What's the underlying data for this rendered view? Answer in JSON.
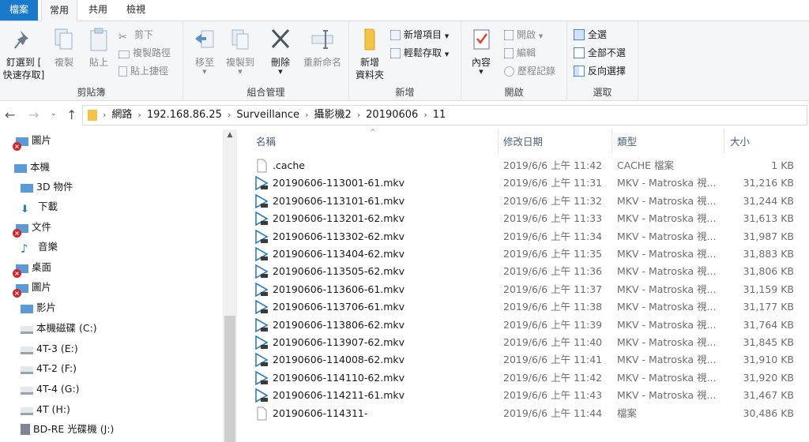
{
  "tabs": [
    {
      "label": "檔案"
    },
    {
      "label": "常用"
    },
    {
      "label": "共用"
    },
    {
      "label": "檢視"
    }
  ],
  "ribbon": {
    "clipboard": {
      "label": "剪貼簿",
      "pin": "釘選到 [\n快速存取]",
      "copy": "複製",
      "paste": "貼上",
      "cut": "剪下",
      "copy_path": "複製路徑",
      "paste_shortcut": "貼上捷徑"
    },
    "organize": {
      "label": "組合管理",
      "move_to": "移至",
      "copy_to": "複製到",
      "delete": "刪除",
      "rename": "重新命名"
    },
    "new": {
      "label": "新增",
      "new_folder": "新增\n資料夾",
      "new_item": "新增項目",
      "easy_access": "輕鬆存取"
    },
    "open": {
      "label": "開啟",
      "properties": "內容",
      "open": "開啟",
      "edit": "編輯",
      "history": "歷程記錄"
    },
    "select": {
      "label": "選取",
      "select_all": "全選",
      "select_none": "全部不選",
      "invert": "反向選擇"
    }
  },
  "address": {
    "crumbs": [
      "網路",
      "192.168.86.25",
      "Surveillance",
      "攝影機2",
      "20190606",
      "11"
    ]
  },
  "navpane": {
    "items": [
      {
        "label": "圖片",
        "icon": "pictures-icon",
        "error": true
      },
      {
        "label": "本機",
        "icon": "this-pc-icon",
        "error": false
      },
      {
        "label": "3D 物件",
        "icon": "3d-objects-icon",
        "error": false
      },
      {
        "label": "下載",
        "icon": "downloads-icon",
        "error": false
      },
      {
        "label": "文件",
        "icon": "documents-icon",
        "error": true
      },
      {
        "label": "音樂",
        "icon": "music-icon",
        "error": false
      },
      {
        "label": "桌面",
        "icon": "desktop-icon",
        "error": true
      },
      {
        "label": "圖片",
        "icon": "pictures-icon",
        "error": true
      },
      {
        "label": "影片",
        "icon": "videos-icon",
        "error": false
      },
      {
        "label": "本機磁碟 (C:)",
        "icon": "local-disk-icon",
        "error": false
      },
      {
        "label": "4T-3 (E:)",
        "icon": "drive-icon",
        "error": false
      },
      {
        "label": "4T-2 (F:)",
        "icon": "drive-icon",
        "error": false
      },
      {
        "label": "4T-4 (G:)",
        "icon": "drive-icon",
        "error": false
      },
      {
        "label": "4T (H:)",
        "icon": "drive-icon",
        "error": false
      },
      {
        "label": "BD-RE 光碟機 (J:)",
        "icon": "optical-drive-icon",
        "error": false
      }
    ]
  },
  "filelist": {
    "columns": {
      "name": "名稱",
      "date": "修改日期",
      "type": "類型",
      "size": "大小"
    },
    "files": [
      {
        "name": ".cache",
        "date": "2019/6/6 上午 11:42",
        "type": "CACHE 檔案",
        "size": "1 KB",
        "icon": "file-icon"
      },
      {
        "name": "20190606-113001-61.mkv",
        "date": "2019/6/6 上午 11:31",
        "type": "MKV - Matroska 視...",
        "size": "31,216 KB",
        "icon": "video-file-icon"
      },
      {
        "name": "20190606-113101-61.mkv",
        "date": "2019/6/6 上午 11:32",
        "type": "MKV - Matroska 視...",
        "size": "31,244 KB",
        "icon": "video-file-icon"
      },
      {
        "name": "20190606-113201-62.mkv",
        "date": "2019/6/6 上午 11:33",
        "type": "MKV - Matroska 視...",
        "size": "31,613 KB",
        "icon": "video-file-icon"
      },
      {
        "name": "20190606-113302-62.mkv",
        "date": "2019/6/6 上午 11:34",
        "type": "MKV - Matroska 視...",
        "size": "31,987 KB",
        "icon": "video-file-icon"
      },
      {
        "name": "20190606-113404-62.mkv",
        "date": "2019/6/6 上午 11:35",
        "type": "MKV - Matroska 視...",
        "size": "31,883 KB",
        "icon": "video-file-icon"
      },
      {
        "name": "20190606-113505-62.mkv",
        "date": "2019/6/6 上午 11:36",
        "type": "MKV - Matroska 視...",
        "size": "31,806 KB",
        "icon": "video-file-icon"
      },
      {
        "name": "20190606-113606-61.mkv",
        "date": "2019/6/6 上午 11:37",
        "type": "MKV - Matroska 視...",
        "size": "31,159 KB",
        "icon": "video-file-icon"
      },
      {
        "name": "20190606-113706-61.mkv",
        "date": "2019/6/6 上午 11:38",
        "type": "MKV - Matroska 視...",
        "size": "31,177 KB",
        "icon": "video-file-icon"
      },
      {
        "name": "20190606-113806-62.mkv",
        "date": "2019/6/6 上午 11:39",
        "type": "MKV - Matroska 視...",
        "size": "31,764 KB",
        "icon": "video-file-icon"
      },
      {
        "name": "20190606-113907-62.mkv",
        "date": "2019/6/6 上午 11:40",
        "type": "MKV - Matroska 視...",
        "size": "31,845 KB",
        "icon": "video-file-icon"
      },
      {
        "name": "20190606-114008-62.mkv",
        "date": "2019/6/6 上午 11:41",
        "type": "MKV - Matroska 視...",
        "size": "31,910 KB",
        "icon": "video-file-icon"
      },
      {
        "name": "20190606-114110-62.mkv",
        "date": "2019/6/6 上午 11:42",
        "type": "MKV - Matroska 視...",
        "size": "31,920 KB",
        "icon": "video-file-icon"
      },
      {
        "name": "20190606-114211-61.mkv",
        "date": "2019/6/6 上午 11:43",
        "type": "MKV - Matroska 視...",
        "size": "31,467 KB",
        "icon": "video-file-icon"
      },
      {
        "name": "20190606-114311-",
        "date": "2019/6/6 上午 11:44",
        "type": "檔案",
        "size": "30,486 KB",
        "icon": "file-icon"
      }
    ]
  },
  "colors": {
    "file_tab": "#1979ca",
    "header_text": "#4c607a",
    "error_badge": "#d4252a",
    "folder_yellow": "#f5c342",
    "video_icon": "#2d7fc1"
  }
}
